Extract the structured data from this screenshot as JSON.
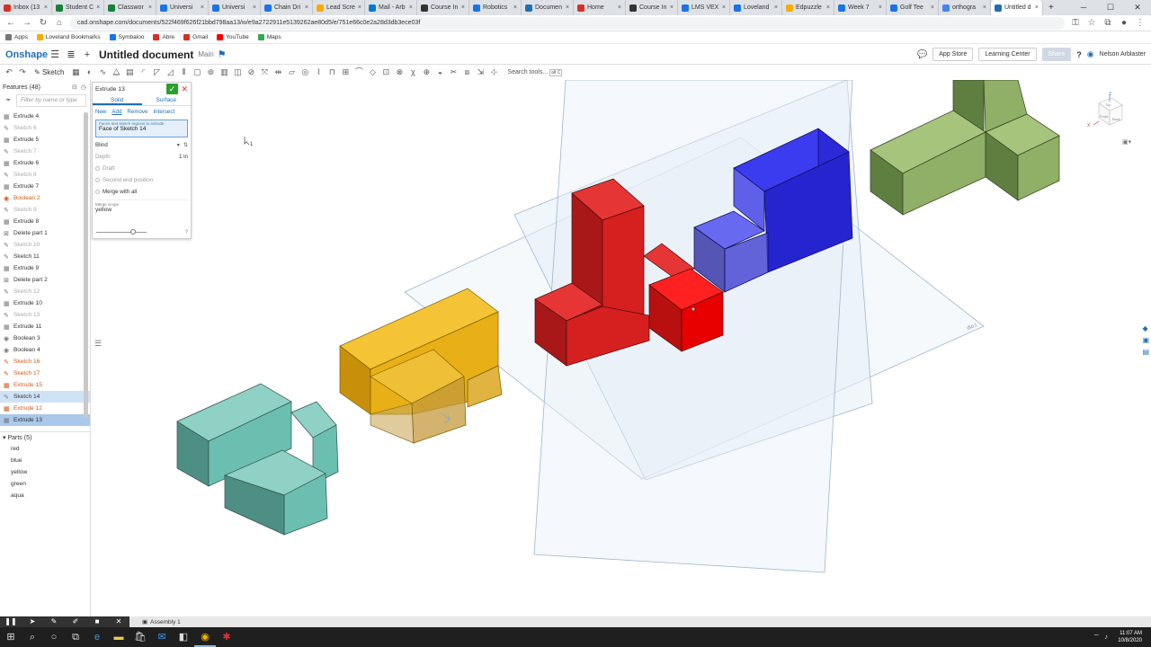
{
  "browser": {
    "tabs": [
      {
        "label": "Inbox (13",
        "color": "#d93025"
      },
      {
        "label": "Student C",
        "color": "#188038"
      },
      {
        "label": "Classwor",
        "color": "#188038"
      },
      {
        "label": "Universi",
        "color": "#1a73e8"
      },
      {
        "label": "Universi",
        "color": "#1a73e8"
      },
      {
        "label": "Chain Dri",
        "color": "#1a73e8"
      },
      {
        "label": "Lead Scre",
        "color": "#f9ab00"
      },
      {
        "label": "Mail - Arb",
        "color": "#0078d4"
      },
      {
        "label": "Course In",
        "color": "#333333"
      },
      {
        "label": "Robotics",
        "color": "#1a73e8"
      },
      {
        "label": "Documen",
        "color": "#1f6fb5"
      },
      {
        "label": "Home",
        "color": "#d93025"
      },
      {
        "label": "Course In",
        "color": "#333333"
      },
      {
        "label": "LMS VEX",
        "color": "#1a73e8"
      },
      {
        "label": "Loveland",
        "color": "#1a73e8"
      },
      {
        "label": "Edpuzzle",
        "color": "#f9ab00"
      },
      {
        "label": "Week 7",
        "color": "#1a73e8"
      },
      {
        "label": "Golf Tee",
        "color": "#1a73e8"
      },
      {
        "label": "orthogra",
        "color": "#4285f4"
      },
      {
        "label": "Untitled d",
        "color": "#1f6fb5"
      }
    ],
    "url": "cad.onshape.com/documents/522f469f626f21bbd798aa13/w/e9a2722911e5139262ae80d5/e/751e66c0e2a28d3db3ece03f",
    "bookmarks": [
      {
        "label": "Apps",
        "color": "#777777"
      },
      {
        "label": "Loveland Bookmarks",
        "color": "#f9ab00"
      },
      {
        "label": "Symbaloo",
        "color": "#1a73e8"
      },
      {
        "label": "Abre",
        "color": "#d93025"
      },
      {
        "label": "Gmail",
        "color": "#d93025"
      },
      {
        "label": "YouTube",
        "color": "#ff0000"
      },
      {
        "label": "Maps",
        "color": "#34a853"
      }
    ]
  },
  "app": {
    "logo": "Onshape",
    "title": "Untitled document",
    "branch": "Main",
    "app_store": "App Store",
    "learning_center": "Learning Center",
    "share": "Share",
    "help": "?",
    "user": "Nelson Arblaster",
    "sketch_label": "Sketch",
    "search_tools": "Search tools...",
    "search_shortcut": "alt C"
  },
  "features_panel": {
    "title": "Features (48)",
    "filter_placeholder": "Filter by name or type",
    "items": [
      {
        "label": "Extrude 4",
        "type": "extrude",
        "state": "normal"
      },
      {
        "label": "Sketch 6",
        "type": "sketch",
        "state": "dim"
      },
      {
        "label": "Extrude 5",
        "type": "extrude",
        "state": "normal"
      },
      {
        "label": "Sketch 7",
        "type": "sketch",
        "state": "dim"
      },
      {
        "label": "Extrude 6",
        "type": "extrude",
        "state": "normal"
      },
      {
        "label": "Sketch 8",
        "type": "sketch",
        "state": "dim"
      },
      {
        "label": "Extrude 7",
        "type": "extrude",
        "state": "normal"
      },
      {
        "label": "Boolean 2",
        "type": "boolean",
        "state": "err"
      },
      {
        "label": "Sketch 9",
        "type": "sketch",
        "state": "dim"
      },
      {
        "label": "Extrude 8",
        "type": "extrude",
        "state": "normal"
      },
      {
        "label": "Delete part 1",
        "type": "delete",
        "state": "normal"
      },
      {
        "label": "Sketch 10",
        "type": "sketch",
        "state": "dim"
      },
      {
        "label": "Sketch 11",
        "type": "sketch",
        "state": "normal"
      },
      {
        "label": "Extrude 9",
        "type": "extrude",
        "state": "normal"
      },
      {
        "label": "Delete part 2",
        "type": "delete",
        "state": "normal"
      },
      {
        "label": "Sketch 12",
        "type": "sketch",
        "state": "dim"
      },
      {
        "label": "Extrude 10",
        "type": "extrude",
        "state": "normal"
      },
      {
        "label": "Sketch 13",
        "type": "sketch",
        "state": "dim"
      },
      {
        "label": "Extrude 11",
        "type": "extrude",
        "state": "normal"
      },
      {
        "label": "Boolean 3",
        "type": "boolean",
        "state": "normal"
      },
      {
        "label": "Boolean 4",
        "type": "boolean",
        "state": "normal"
      },
      {
        "label": "Sketch 16",
        "type": "sketch",
        "state": "err"
      },
      {
        "label": "Sketch 17",
        "type": "sketch",
        "state": "err"
      },
      {
        "label": "Extrude 15",
        "type": "extrude",
        "state": "err"
      },
      {
        "label": "Sketch 14",
        "type": "sketch",
        "state": "sel"
      },
      {
        "label": "Extrude 12",
        "type": "extrude",
        "state": "err"
      },
      {
        "label": "Extrude 13",
        "type": "extrude",
        "state": "seldark"
      }
    ],
    "parts_title": "Parts (5)",
    "parts": [
      "red",
      "blue",
      "yellow",
      "green",
      "aqua"
    ]
  },
  "dialog": {
    "title": "Extrude 13",
    "tab_solid": "Solid",
    "tab_surface": "Surface",
    "ops": [
      "New",
      "Add",
      "Remove",
      "Intersect"
    ],
    "active_op": "Add",
    "faces_label": "Faces and sketch regions to extrude",
    "faces_value": "Face of Sketch 14",
    "end_type": "Blind",
    "depth_label": "Depth",
    "depth_value": "1 in",
    "draft": "Draft",
    "second_end": "Second end position",
    "merge_all": "Merge with all",
    "merge_scope_label": "Merge scope",
    "merge_scope_value": "yellow",
    "help": "?"
  },
  "viewport": {
    "plane_label": "dio.l",
    "cursor_badge": "1",
    "view_cube": {
      "top": "Top",
      "front": "Front",
      "back": "Back",
      "x": "X",
      "z": "Z"
    }
  },
  "bottom": {
    "assembly_tab": "Assembly 1"
  },
  "taskbar": {
    "time": "11:07 AM",
    "date": "10/8/2020"
  },
  "colors": {
    "red": "#d62020",
    "blue": "#2a2ad8",
    "yellow": "#e8b016",
    "green": "#8fb066",
    "aqua": "#6bbfb0"
  }
}
